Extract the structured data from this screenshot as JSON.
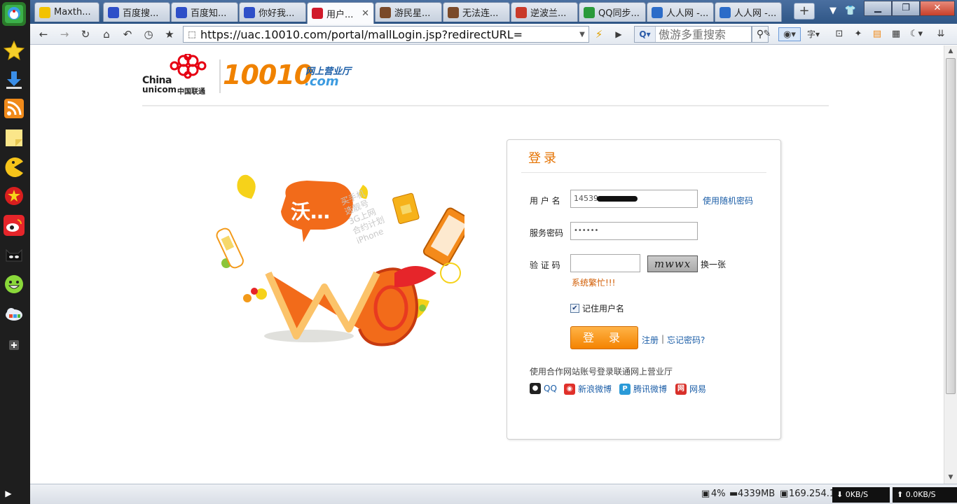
{
  "browser": {
    "tabs": [
      {
        "label": "Maxth...",
        "color": "#f2c200"
      },
      {
        "label": "百度搜...",
        "color": "#2e4fc8"
      },
      {
        "label": "百度知...",
        "color": "#2e4fc8"
      },
      {
        "label": "你好我...",
        "color": "#2e4fc8"
      },
      {
        "label": "用户...",
        "color": "#d11a2a",
        "active": true
      },
      {
        "label": "游民星...",
        "color": "#7a4a2a"
      },
      {
        "label": "无法连...",
        "color": "#7a4a2a"
      },
      {
        "label": "逆波兰...",
        "color": "#c93a2a"
      },
      {
        "label": "QQ同步...",
        "color": "#2a9a3a"
      },
      {
        "label": "人人网 -...",
        "color": "#2c6cc8"
      },
      {
        "label": "人人网 -...",
        "color": "#2c6cc8"
      }
    ],
    "url": "https://uac.10010.com/portal/mallLogin.jsp?redirectURL=",
    "search_placeholder": "傲游多重搜索"
  },
  "logo": {
    "brand_en_1": "China",
    "brand_en_2": "unicom",
    "brand_cn": "中国联通",
    "number": "10010",
    "subtitle": "网上营业厅",
    "domain": ".com"
  },
  "illustration": {
    "bubble_text": "沃…",
    "side_text": [
      "买手机",
      "选靓号",
      "3G上网",
      "合约计划",
      "iPhone"
    ]
  },
  "login": {
    "title": "登录",
    "username_label": "用 户 名",
    "username_value": "14539",
    "random_password_link": "使用随机密码",
    "password_label": "服务密码",
    "password_value": "••••••",
    "captcha_label": "验 证 码",
    "captcha_value": "",
    "captcha_text": "mwwx",
    "captcha_refresh": "换一张",
    "error_text": "系统繁忙!!!",
    "remember_label": "记住用户名",
    "remember_checked": true,
    "login_button": "登 录",
    "register_link": "注册",
    "link_separator": "|",
    "forgot_link": "忘记密码?",
    "partner_text": "使用合作网站账号登录联通网上营业厅",
    "partners": [
      {
        "name": "QQ",
        "color": "#1f8ae0"
      },
      {
        "name": "新浪微博",
        "color": "#e0302a"
      },
      {
        "name": "腾讯微博",
        "color": "#2a9ad8"
      },
      {
        "name": "网易",
        "color": "#d8302a"
      }
    ]
  },
  "status": {
    "cpu": "4%",
    "memory": "4339MB",
    "ip": "169.254.1",
    "download": "0KB/S",
    "upload": "0.0KB/S"
  }
}
